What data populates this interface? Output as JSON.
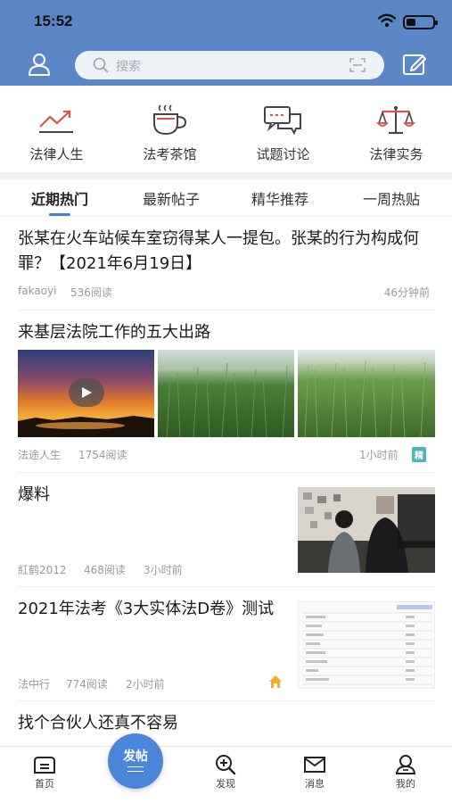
{
  "status_bar": {
    "time": "15:52",
    "battery_level": 0.35
  },
  "header": {
    "search_placeholder": "搜索"
  },
  "categories": [
    {
      "label": "法律人生",
      "icon": "chart-line-icon"
    },
    {
      "label": "法考茶馆",
      "icon": "tea-cup-icon"
    },
    {
      "label": "试题讨论",
      "icon": "chat-bubbles-icon"
    },
    {
      "label": "法律实务",
      "icon": "scales-icon"
    }
  ],
  "tabs": [
    {
      "label": "近期热门",
      "active": true
    },
    {
      "label": "最新帖子",
      "active": false
    },
    {
      "label": "精华推荐",
      "active": false
    },
    {
      "label": "一周热贴",
      "active": false
    }
  ],
  "posts": [
    {
      "title": "张某在火车站候车室窃得某人一提包。张某的行为构成何罪？【2021年6月19日】",
      "author": "fakaoyi",
      "reads": "536阅读",
      "time": "46分钟前"
    },
    {
      "title": "来基层法院工作的五大出路",
      "author": "法途人生",
      "reads": "1754阅读",
      "time": "1小时前",
      "badge": "精"
    },
    {
      "title": "爆料",
      "author": "紅鹤2012",
      "reads": "468阅读",
      "time": "3小时前"
    },
    {
      "title": "2021年法考《3大实体法D卷》测试",
      "author": "法中行",
      "reads": "774阅读",
      "time": "2小时前"
    },
    {
      "title": "找个合伙人还真不容易"
    }
  ],
  "tabbar": {
    "home": "首页",
    "post": "发帖",
    "discover": "发现",
    "messages": "消息",
    "mine": "我的"
  },
  "colors": {
    "header_bg": "#5b86c8",
    "accent": "#4a7cc8",
    "icon_red": "#d9534f"
  }
}
